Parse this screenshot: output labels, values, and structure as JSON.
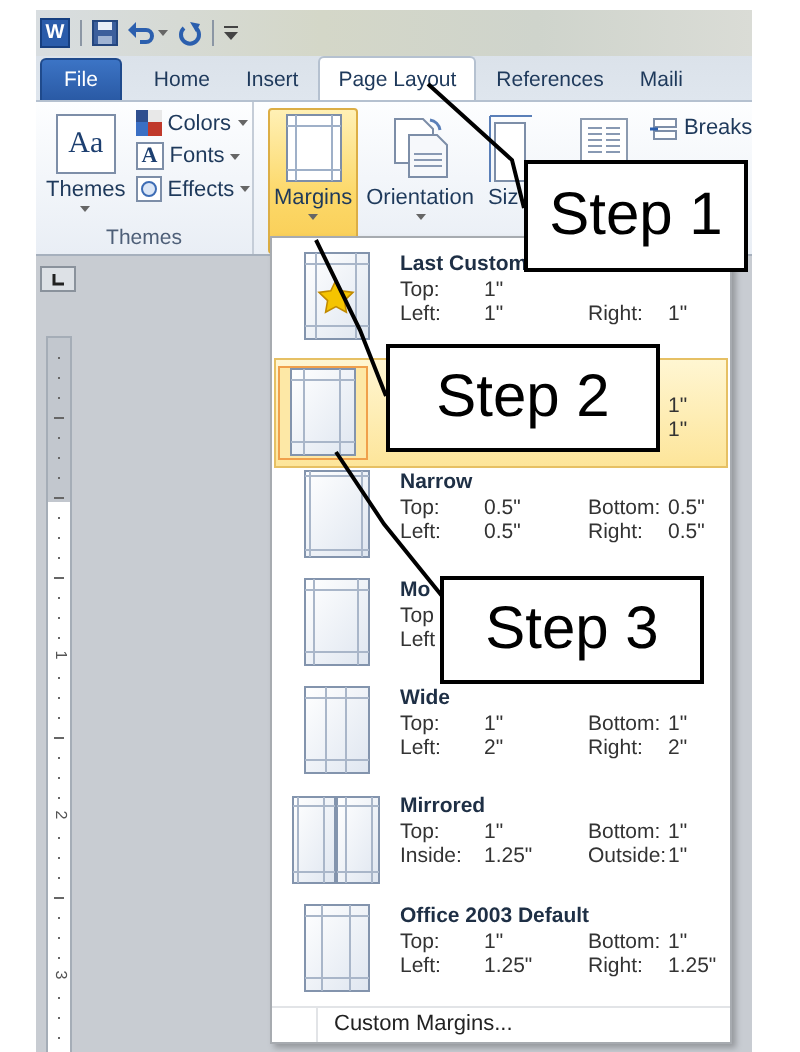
{
  "quick_access": {
    "logo": "W"
  },
  "tabs": [
    {
      "label": "File",
      "kind": "file",
      "selected": false
    },
    {
      "label": "Home",
      "kind": "tab",
      "selected": false
    },
    {
      "label": "Insert",
      "kind": "tab",
      "selected": false
    },
    {
      "label": "Page Layout",
      "kind": "tab",
      "selected": true
    },
    {
      "label": "References",
      "kind": "tab",
      "selected": false
    },
    {
      "label": "Maili",
      "kind": "tab",
      "selected": false
    }
  ],
  "themes_group": {
    "themes_button": {
      "icon_text": "Aa",
      "label": "Themes"
    },
    "items": [
      {
        "label": "Colors"
      },
      {
        "label": "Fonts",
        "icon_text": "A"
      },
      {
        "label": "Effects"
      }
    ],
    "label": "Themes"
  },
  "page_setup": {
    "buttons": [
      {
        "label": "Margins",
        "selected": true
      },
      {
        "label": "Orientation",
        "selected": false
      },
      {
        "label": "Siz",
        "selected": false
      }
    ],
    "breaks": {
      "label": "Breaks"
    }
  },
  "ruler": {
    "numbers": [
      "1",
      "2",
      "3"
    ]
  },
  "margins_menu": {
    "items": [
      {
        "name": "Last Custom",
        "selected": false,
        "lines": [
          {
            "left_label": "Top:",
            "left_value": "1\""
          },
          {
            "left_label": "Left:",
            "left_value": "1\"",
            "right_label": "Right:",
            "right_value": "1\""
          }
        ]
      },
      {
        "selected": true,
        "lines": [
          {
            "right_value": "1\""
          },
          {
            "right_value": "1\""
          }
        ]
      },
      {
        "name": "Narrow",
        "selected": false,
        "lines": [
          {
            "left_label": "Top:",
            "left_value": "0.5\"",
            "right_label": "Bottom:",
            "right_value": "0.5\""
          },
          {
            "left_label": "Left:",
            "left_value": "0.5\"",
            "right_label": "Right:",
            "right_value": "0.5\""
          }
        ]
      },
      {
        "name": "Mo",
        "selected": false,
        "lines": [
          {
            "left_label": "Top"
          },
          {
            "left_label": "Left"
          }
        ]
      },
      {
        "name": "Wide",
        "selected": false,
        "lines": [
          {
            "left_label": "Top:",
            "left_value": "1\"",
            "right_label": "Bottom:",
            "right_value": "1\""
          },
          {
            "left_label": "Left:",
            "left_value": "2\"",
            "right_label": "Right:",
            "right_value": "2\""
          }
        ]
      },
      {
        "name": "Mirrored",
        "selected": false,
        "lines": [
          {
            "left_label": "Top:",
            "left_value": "1\"",
            "right_label": "Bottom:",
            "right_value": "1\""
          },
          {
            "left_label": "Inside:",
            "left_value": "1.25\"",
            "right_label": "Outside:",
            "right_value": "1\""
          }
        ]
      },
      {
        "name": "Office 2003 Default",
        "selected": false,
        "lines": [
          {
            "left_label": "Top:",
            "left_value": "1\"",
            "right_label": "Bottom:",
            "right_value": "1\""
          },
          {
            "left_label": "Left:",
            "left_value": "1.25\"",
            "right_label": "Right:",
            "right_value": "1.25\""
          }
        ]
      }
    ],
    "footer": "Custom Margins..."
  },
  "callouts": [
    {
      "text": "Step 1"
    },
    {
      "text": "Step 2"
    },
    {
      "text": "Step 3"
    }
  ]
}
